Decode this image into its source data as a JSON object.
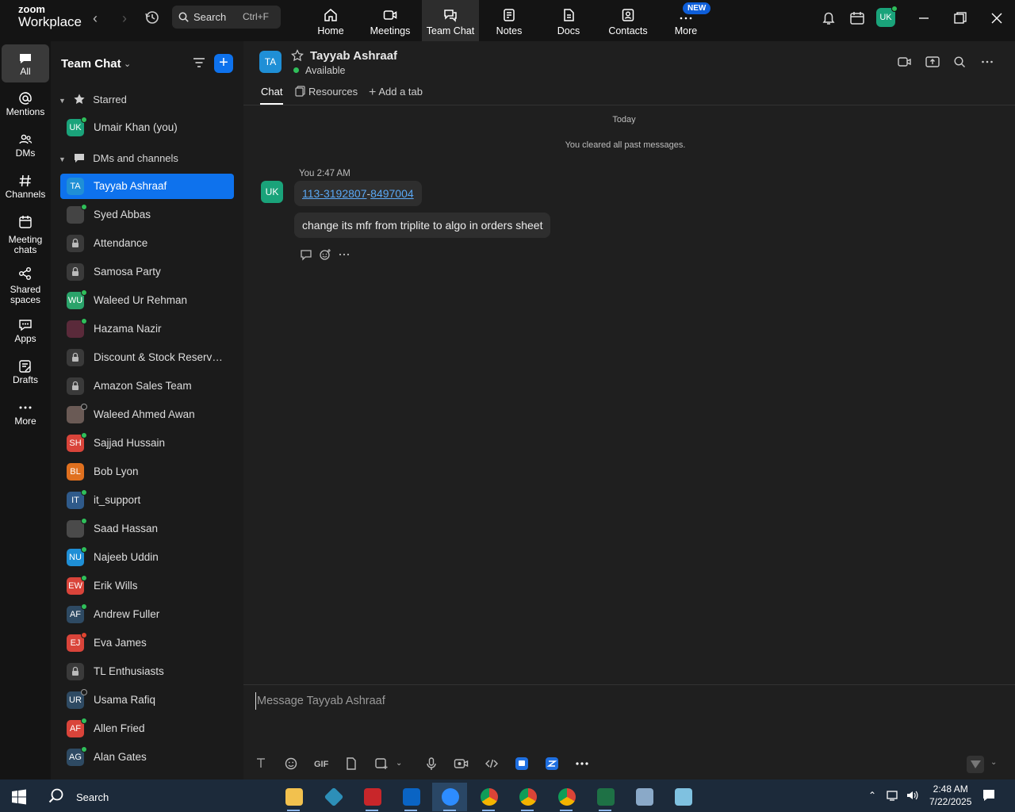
{
  "topbar": {
    "logo_line1": "zoom",
    "logo_line2": "Workplace",
    "search_label": "Search",
    "search_shortcut": "Ctrl+F",
    "tabs": [
      {
        "label": "Home",
        "icon": "home-icon"
      },
      {
        "label": "Meetings",
        "icon": "video-camera-icon"
      },
      {
        "label": "Team Chat",
        "icon": "chat-bubbles-icon",
        "active": true
      },
      {
        "label": "Notes",
        "icon": "notes-icon"
      },
      {
        "label": "Docs",
        "icon": "docs-icon"
      },
      {
        "label": "Contacts",
        "icon": "contacts-icon"
      },
      {
        "label": "More",
        "icon": "more-dots-icon"
      }
    ],
    "new_badge": "NEW",
    "user_initials": "UK"
  },
  "rail": [
    {
      "label": "All",
      "icon": "chat-icon",
      "active": true
    },
    {
      "label": "Mentions",
      "icon": "at-icon"
    },
    {
      "label": "DMs",
      "icon": "people-icon"
    },
    {
      "label": "Channels",
      "icon": "hash-icon"
    },
    {
      "label": "Meeting chats",
      "icon": "calendar-icon"
    },
    {
      "label": "Shared spaces",
      "icon": "share-icon"
    },
    {
      "label": "Apps",
      "icon": "apps-icon"
    },
    {
      "label": "Drafts",
      "icon": "drafts-icon"
    },
    {
      "label": "More",
      "icon": "more-icon"
    }
  ],
  "sidebar": {
    "title": "Team Chat",
    "starred_label": "Starred",
    "dms_label": "DMs and channels",
    "starred": [
      {
        "name": "Umair Khan (you)",
        "initials": "UK",
        "color": "#1aa37a",
        "status": "online"
      }
    ],
    "items": [
      {
        "name": "Tayyab Ashraaf",
        "initials": "TA",
        "color": "#1f8fd6",
        "selected": true
      },
      {
        "name": "Syed Abbas",
        "initials": "",
        "color": "#444",
        "status": "online",
        "photo": true
      },
      {
        "name": "Attendance",
        "lock": true
      },
      {
        "name": "Samosa Party",
        "lock": true
      },
      {
        "name": "Waleed Ur Rehman",
        "initials": "WU",
        "color": "#2aa36a",
        "status": "online"
      },
      {
        "name": "Hazama Nazir",
        "initials": "",
        "color": "#5a2a3a",
        "status": "online",
        "photo": true
      },
      {
        "name": "Discount & Stock Reservati...",
        "lock": true
      },
      {
        "name": "Amazon Sales Team",
        "lock": true
      },
      {
        "name": "Waleed Ahmed Awan",
        "initials": "",
        "color": "#6a5a55",
        "status": "offline",
        "photo": true
      },
      {
        "name": "Sajjad Hussain",
        "initials": "SH",
        "color": "#d9443a",
        "status": "online"
      },
      {
        "name": "Bob Lyon",
        "initials": "BL",
        "color": "#e0701f",
        "status": "none"
      },
      {
        "name": "it_support",
        "initials": "IT",
        "color": "#2f5a8a",
        "status": "online",
        "photo": true
      },
      {
        "name": "Saad Hassan",
        "initials": "",
        "color": "#4a4a4a",
        "status": "online",
        "photo": true
      },
      {
        "name": "Najeeb Uddin",
        "initials": "NU",
        "color": "#1f8fd6",
        "status": "online"
      },
      {
        "name": "Erik Wills",
        "initials": "EW",
        "color": "#d9443a",
        "status": "online"
      },
      {
        "name": "Andrew Fuller",
        "initials": "AF",
        "color": "#2e4a63",
        "status": "online"
      },
      {
        "name": "Eva James",
        "initials": "EJ",
        "color": "#d9443a",
        "status": "busy"
      },
      {
        "name": "TL Enthusiasts",
        "lock": true
      },
      {
        "name": "Usama Rafiq",
        "initials": "UR",
        "color": "#2e4a63",
        "status": "offline"
      },
      {
        "name": "Allen Fried",
        "initials": "AF",
        "color": "#d9443a",
        "status": "online"
      },
      {
        "name": "Alan Gates",
        "initials": "AG",
        "color": "#2e4a63",
        "status": "online"
      }
    ]
  },
  "chat": {
    "contact_initials": "TA",
    "contact_name": "Tayyab Ashraaf",
    "contact_status": "Available",
    "tabs": {
      "chat": "Chat",
      "resources": "Resources",
      "add": "Add a tab"
    },
    "date_divider": "Today",
    "system_note": "You cleared all past messages.",
    "message": {
      "sender_initials": "UK",
      "meta": "You 2:47 AM",
      "link_part1": "113-3192807",
      "link_sep": "-",
      "link_part2": "8497004",
      "text": "change its mfr from triplite to algo in orders sheet"
    },
    "composer_placeholder": "Message Tayyab Ashraaf",
    "composer_gif": "GIF"
  },
  "taskbar": {
    "search_label": "Search",
    "time": "2:48 AM",
    "date": "7/22/2025"
  }
}
